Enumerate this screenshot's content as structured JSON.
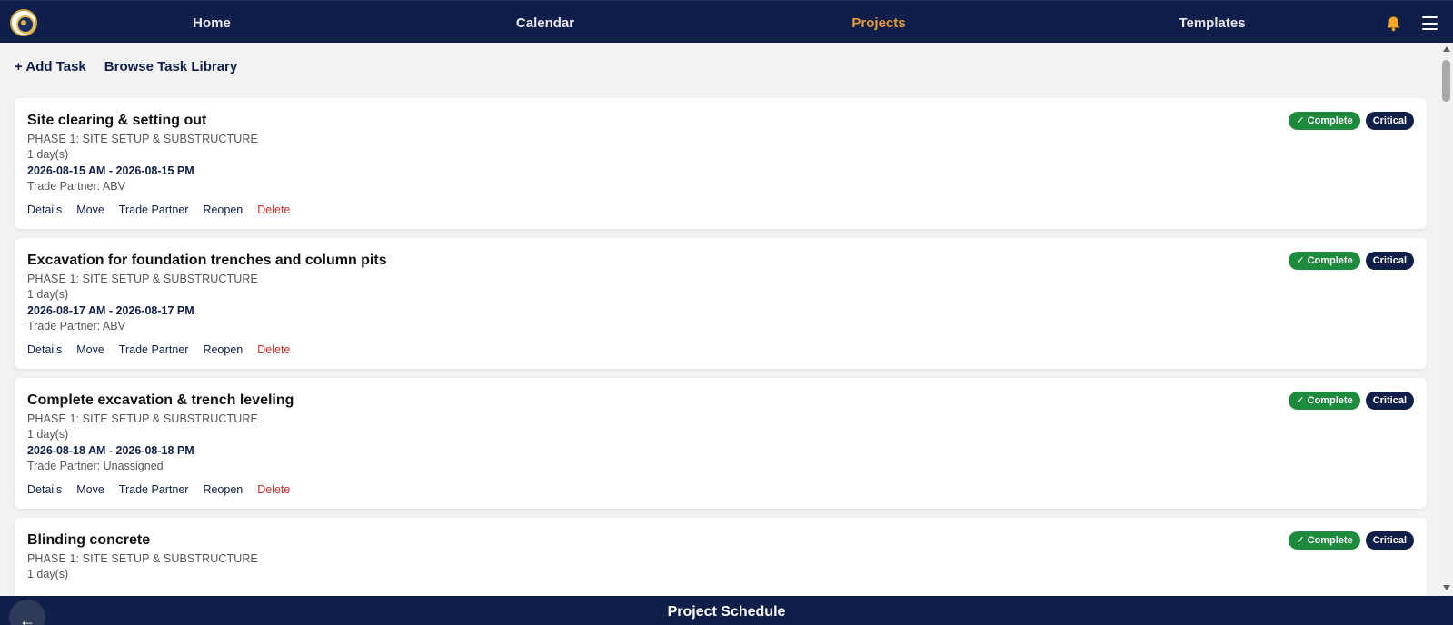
{
  "nav": {
    "links": [
      "Home",
      "Calendar",
      "Projects",
      "Templates"
    ],
    "active": "Projects",
    "active_color": "#e59a3a",
    "bg_color": "#101f4a",
    "icons": [
      "logo",
      "bell-icon",
      "menu-icon"
    ]
  },
  "toolbar": {
    "add_task": "+ Add Task",
    "browse_library": "Browse Task Library"
  },
  "tasks": [
    {
      "title": "Site clearing & setting out",
      "phase": "PHASE 1: SITE SETUP & SUBSTRUCTURE",
      "duration": "1 day(s)",
      "dates": "2026-08-15 AM - 2026-08-15 PM",
      "partner": "Trade Partner: ABV",
      "status": "✓ Complete",
      "priority": "Critical"
    },
    {
      "title": "Excavation for foundation trenches and column pits",
      "phase": "PHASE 1: SITE SETUP & SUBSTRUCTURE",
      "duration": "1 day(s)",
      "dates": "2026-08-17 AM - 2026-08-17 PM",
      "partner": "Trade Partner: ABV",
      "status": "✓ Complete",
      "priority": "Critical"
    },
    {
      "title": "Complete excavation & trench leveling",
      "phase": "PHASE 1: SITE SETUP & SUBSTRUCTURE",
      "duration": "1 day(s)",
      "dates": "2026-08-18 AM - 2026-08-18 PM",
      "partner": "Trade Partner: Unassigned",
      "status": "✓ Complete",
      "priority": "Critical"
    },
    {
      "title": "Blinding concrete",
      "phase": "PHASE 1: SITE SETUP & SUBSTRUCTURE",
      "duration": "1 day(s)",
      "dates": "",
      "partner": "",
      "status": "✓ Complete",
      "priority": "Critical"
    }
  ],
  "task_actions": {
    "details": "Details",
    "move": "Move",
    "trade_partner": "Trade Partner",
    "reopen": "Reopen",
    "delete": "Delete"
  },
  "colors": {
    "complete": "#1e8a3e",
    "critical": "#101f4a",
    "delete": "#d42b2b"
  },
  "bottom": {
    "title": "Project Schedule",
    "back_icon": "arrow-left-icon"
  }
}
